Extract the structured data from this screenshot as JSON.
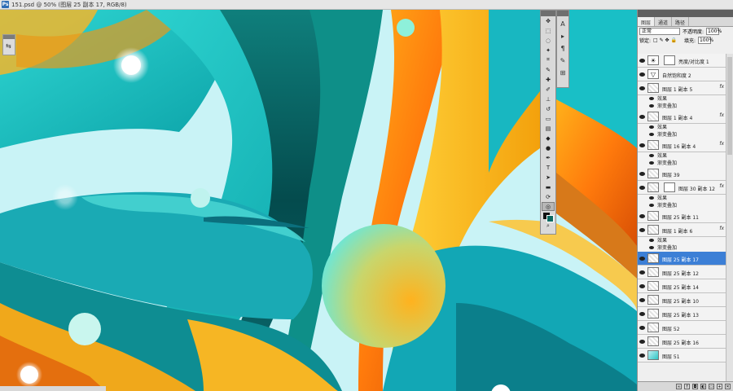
{
  "title": "151.psd @ 50% (图层 25 副本 17, RGB/8)",
  "panel": {
    "tabs": [
      "图层",
      "通道",
      "路径"
    ],
    "blend_mode": "正常",
    "opacity_label": "不透明度:",
    "opacity_value": "100%",
    "lock_label": "锁定:",
    "fill_label": "填充:",
    "fill_value": "100%"
  },
  "layers": [
    {
      "name": "亮度/对比度 1",
      "type": "adjust",
      "fx": false
    },
    {
      "name": "自然饱和度 2",
      "type": "adjust",
      "fx": false
    },
    {
      "name": "图层 1 副本 5",
      "fx": true
    },
    {
      "name": "图层 1 副本 4",
      "fx": true
    },
    {
      "name": "图层 16 副本 4",
      "fx": true
    },
    {
      "name": "图层 39",
      "fx": false
    },
    {
      "name": "图层 30 副本 12",
      "fx": true
    },
    {
      "name": "图层 25 副本 11",
      "fx": false
    },
    {
      "name": "图层 1 副本 6",
      "fx": true
    },
    {
      "name": "图层 25 副本 17",
      "fx": false,
      "selected": true
    },
    {
      "name": "图层 25 副本 12",
      "fx": false
    },
    {
      "name": "图层 25 副本 14",
      "fx": false
    },
    {
      "name": "图层 25 副本 10",
      "fx": false
    },
    {
      "name": "图层 25 副本 13",
      "fx": false
    },
    {
      "name": "图层 52",
      "fx": false
    },
    {
      "name": "图层 25 副本 16",
      "fx": false
    },
    {
      "name": "图层 51",
      "fx": false,
      "img": true
    }
  ],
  "effects": {
    "fx": "fx",
    "effect": "效果",
    "gradient": "渐变叠加"
  }
}
